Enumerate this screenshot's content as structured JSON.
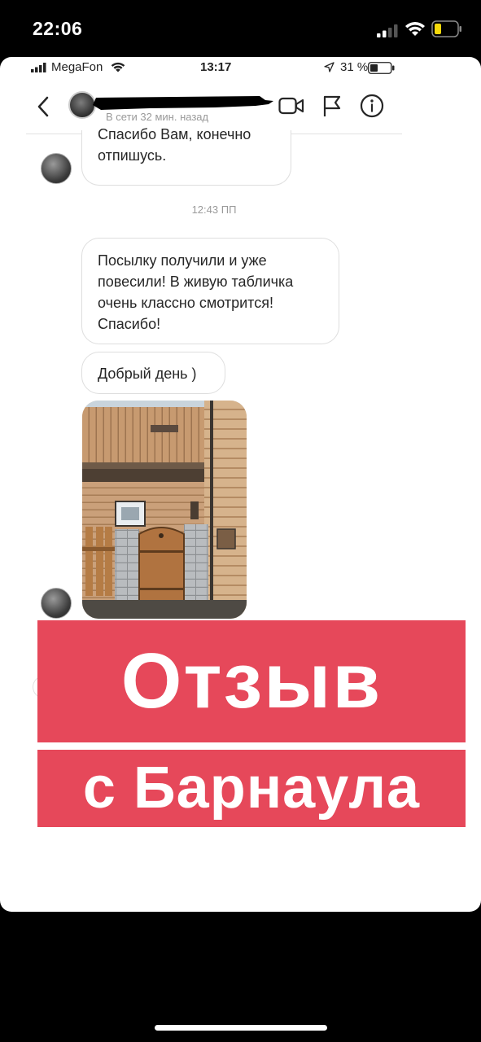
{
  "outer_status": {
    "time": "22:06"
  },
  "inner_status": {
    "carrier": "MegaFon",
    "time": "13:17",
    "battery_percent": "31 %"
  },
  "chat_header": {
    "last_seen": "В сети 32 мин. назад"
  },
  "messages": {
    "top_bubble": "Спасибо Вам, конечно отпишусь.",
    "timestamp": "12:43 ПП",
    "parcel_bubble": "Посылку получили и уже повесили! В живую табличка очень классно смотрится! Спасибо!",
    "greeting_bubble": "Добрый день )"
  },
  "banners": {
    "line1": "Отзыв",
    "line2": "с Барнаула"
  },
  "colors": {
    "banner": "#e6485a",
    "bubble_border": "#dedede"
  }
}
